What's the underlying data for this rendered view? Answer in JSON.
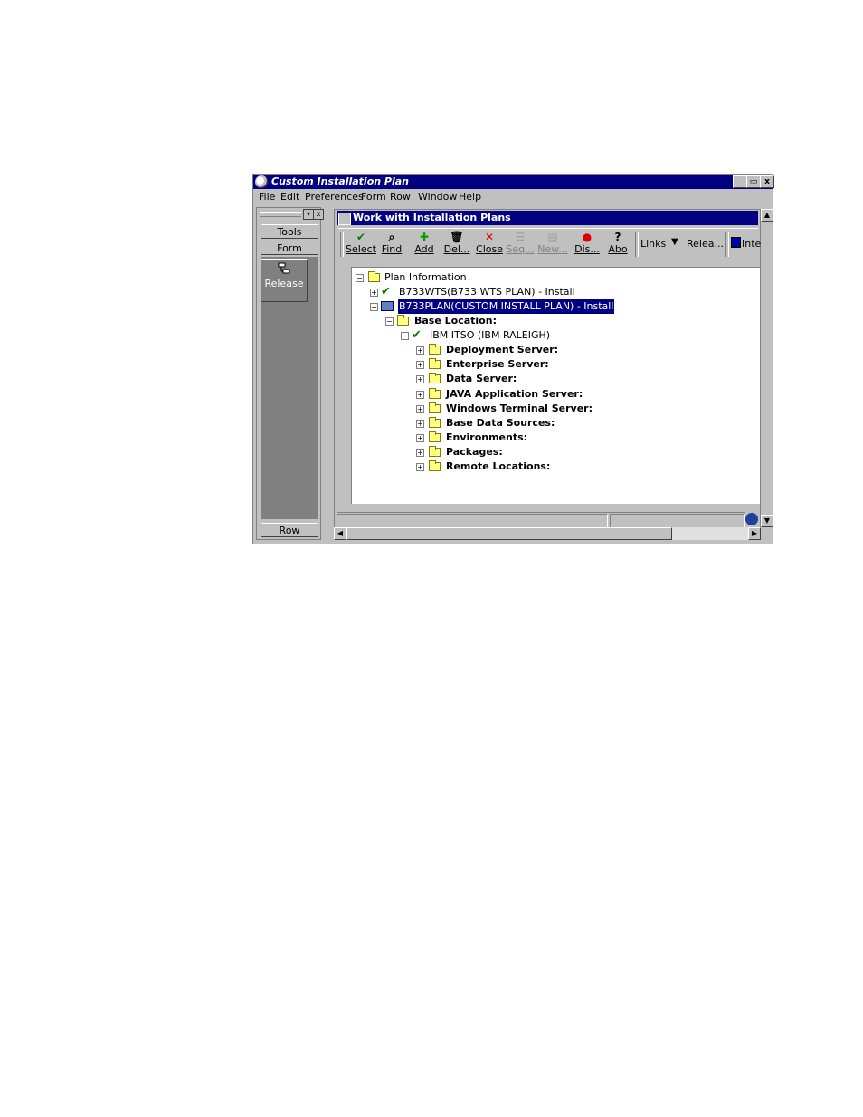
{
  "window": {
    "title": "Custom Installation Plan",
    "controls": {
      "minimize": "_",
      "maximize": "▭",
      "close": "x"
    }
  },
  "menubar": {
    "items": [
      {
        "label": "File"
      },
      {
        "label": "Edit"
      },
      {
        "label": "Preferences"
      },
      {
        "label": "Form"
      },
      {
        "label": "Row"
      },
      {
        "label": "Window"
      },
      {
        "label": "Help"
      }
    ]
  },
  "left_panel": {
    "close": "x",
    "tabs": {
      "tools": "Tools",
      "form": "Form",
      "row": "Row"
    },
    "release_label": "Release"
  },
  "child_window": {
    "title": "Work with Installation Plans"
  },
  "toolbar": {
    "select": "Select",
    "find": "Find",
    "add": "Add",
    "delete": "Del...",
    "close": "Close",
    "seq": "Seq...",
    "new": "New...",
    "dis": "Dis...",
    "abo": "Abo",
    "links": "Links",
    "release": "Relea...",
    "inte": "Inte"
  },
  "tree": {
    "root": "Plan Information",
    "plan1": "B733WTS(B733 WTS PLAN) - Install",
    "plan2": "B733PLAN(CUSTOM INSTALL PLAN) - Install",
    "base_location": "Base Location:",
    "location": "IBM ITSO (IBM RALEIGH)",
    "children": [
      "Deployment Server:",
      "Enterprise Server:",
      "Data Server:",
      "JAVA Application Server:",
      "Windows Terminal Server:",
      "Base Data Sources:",
      "Environments:",
      "Packages:",
      "Remote Locations:"
    ]
  },
  "colors": {
    "titlebar": "#000080",
    "chrome": "#c0c0c0",
    "selection": "#000080",
    "check": "#008000"
  }
}
